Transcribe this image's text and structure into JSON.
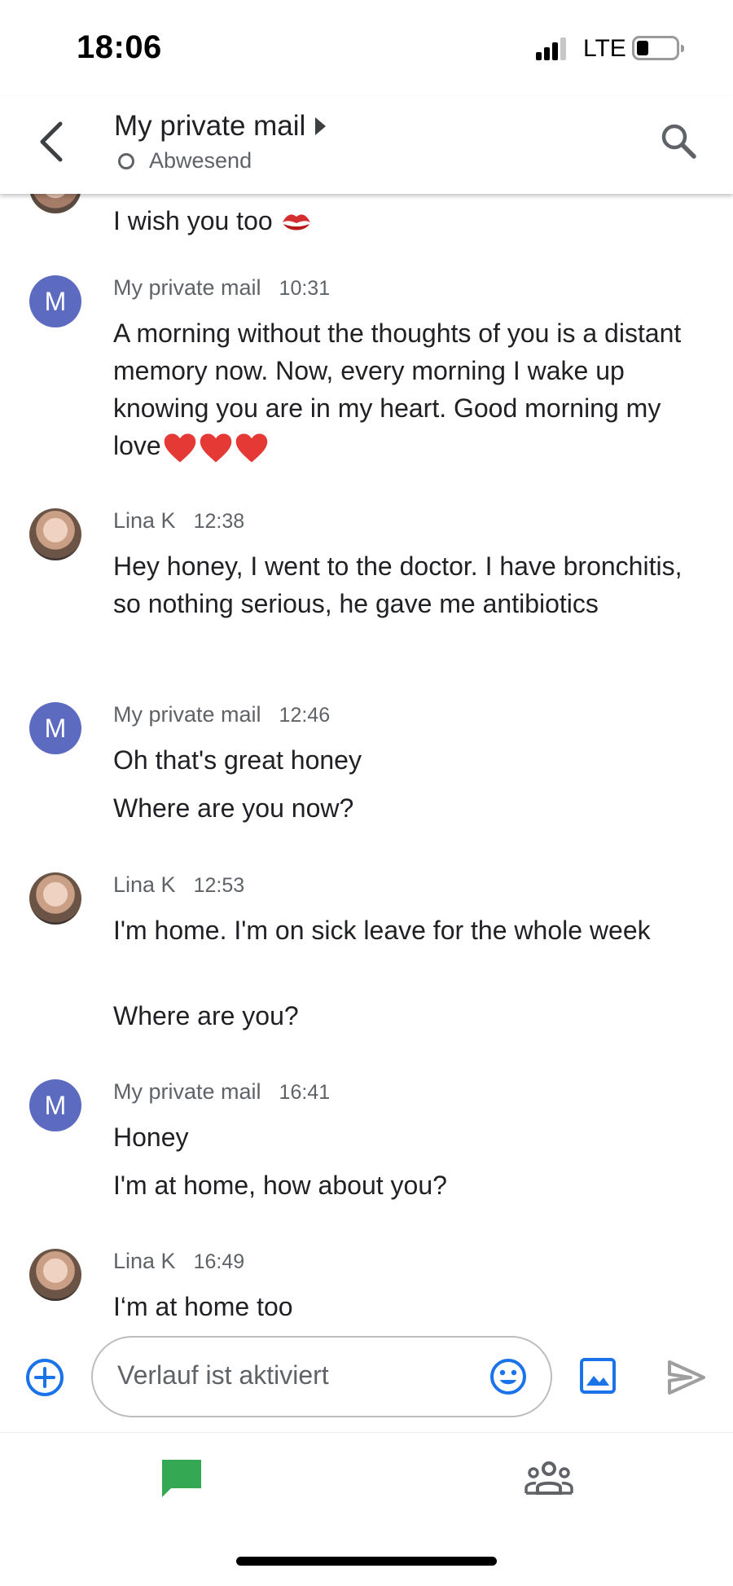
{
  "status_bar": {
    "time": "18:06",
    "network": "LTE"
  },
  "header": {
    "title": "My private mail",
    "presence": "Abwesend"
  },
  "partial_message": {
    "text": "I wish you too",
    "emoji": "kiss-mark-icon"
  },
  "messages": [
    {
      "avatar_letter": "M",
      "sender": "My private mail",
      "time": "10:31",
      "lines": [
        "A morning without the thoughts of you is a distant memory now. Now, every morning I wake up knowing you are in my heart. Good morning my love"
      ]
    },
    {
      "sender": "Lina K",
      "time": "12:38",
      "lines": [
        "Hey honey, I went to the doctor. I have bronchitis, so nothing serious, he gave me antibiotics"
      ]
    },
    {
      "avatar_letter": "M",
      "sender": "My private mail",
      "time": "12:46",
      "lines": [
        "Oh that's great honey",
        "Where are you now?"
      ]
    },
    {
      "sender": "Lina K",
      "time": "12:53",
      "lines": [
        "I'm home. I'm on sick leave for the whole week",
        "Where are you?"
      ]
    },
    {
      "avatar_letter": "M",
      "sender": "My private mail",
      "time": "16:41",
      "lines": [
        "Honey",
        "I'm at home, how about you?"
      ]
    },
    {
      "sender": "Lina K",
      "time": "16:49",
      "lines": [
        "I‘m at home too"
      ]
    }
  ],
  "composer": {
    "placeholder": "Verlauf ist aktiviert"
  },
  "colors": {
    "avatar": "#5c6bc0",
    "accent_blue": "#1a73e8",
    "chat_tab_green": "#34a853",
    "heart_red": "#e53935"
  }
}
